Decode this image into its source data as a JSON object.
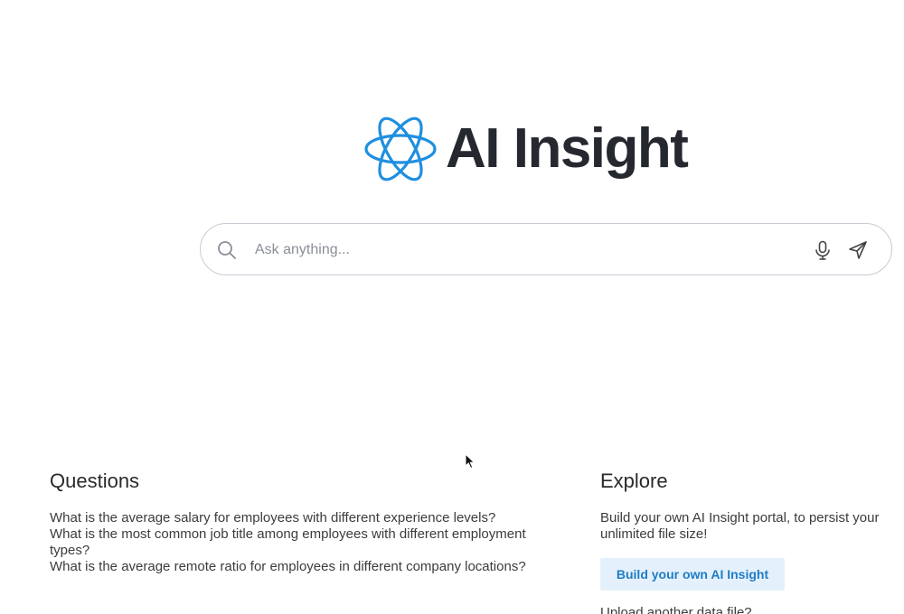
{
  "header": {
    "logo_text": "AI Insight",
    "logo_icon": "atom-icon"
  },
  "search": {
    "placeholder": "Ask anything...",
    "value": "",
    "icons": [
      "search-icon",
      "microphone-icon",
      "send-icon"
    ]
  },
  "questions": {
    "title": "Questions",
    "items": [
      "What is the average salary for employees with different experience levels?",
      "What is the most common job title among employees with different employment types?",
      "What is the average remote ratio for employees in different company locations?"
    ]
  },
  "explore": {
    "title": "Explore",
    "description_line1": "Build your own AI Insight portal, to persist your",
    "description_line2": "unlimited file size!",
    "build_button_label": "Build your own AI Insight",
    "upload_text": "Upload another data file?"
  },
  "colors": {
    "accent": "#1f8fe0",
    "logo_text": "#262830",
    "button_bg": "#e4f1fc",
    "button_text": "#1f7cc4"
  }
}
